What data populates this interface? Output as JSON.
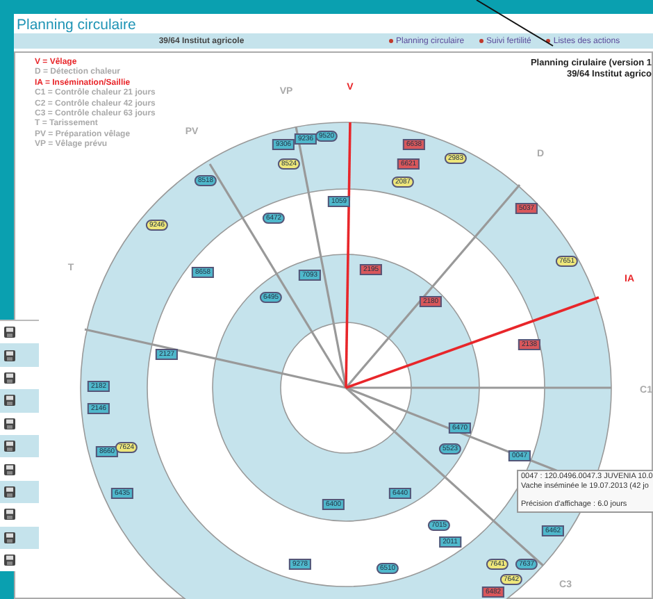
{
  "page_title": "Planning circulaire",
  "nav_bar": {
    "farm": "39/64 Institut agricole",
    "links": [
      {
        "label": "Planning circulaire"
      },
      {
        "label": "Suivi fertilité"
      },
      {
        "label": "Listes des actions"
      }
    ]
  },
  "legend": [
    {
      "text": "V = Vêlage",
      "highlighted": true
    },
    {
      "text": "D = Détection chaleur",
      "highlighted": false
    },
    {
      "text": "IA = Insémination/Saillie",
      "highlighted": true
    },
    {
      "text": "C1 = Contrôle chaleur 21 jours",
      "highlighted": false
    },
    {
      "text": "C2 = Contrôle chaleur 42 jours",
      "highlighted": false
    },
    {
      "text": "C3 = Contrôle chaleur 63 jours",
      "highlighted": false
    },
    {
      "text": "T = Tarissement",
      "highlighted": false
    },
    {
      "text": "PV = Préparation vêlage",
      "highlighted": false
    },
    {
      "text": "VP = Vêlage prévu",
      "highlighted": false
    }
  ],
  "report_header": [
    "Planning cirulaire (version 1",
    "39/64 Institut agrico"
  ],
  "sectors": [
    {
      "label": "V",
      "highlighted": true
    },
    {
      "label": "VP",
      "highlighted": false
    },
    {
      "label": "PV",
      "highlighted": false
    },
    {
      "label": "D",
      "highlighted": false
    },
    {
      "label": "IA",
      "highlighted": true
    },
    {
      "label": "T",
      "highlighted": false
    },
    {
      "label": "C1",
      "highlighted": false
    },
    {
      "label": "C3",
      "highlighted": false
    }
  ],
  "cows": [
    {
      "label": "9306",
      "kind": "rect",
      "color": "#4fb8cc"
    },
    {
      "label": "9236",
      "kind": "rect",
      "color": "#4fb8cc"
    },
    {
      "label": "9520",
      "kind": "oval",
      "color": "#4fb8cc"
    },
    {
      "label": "8524",
      "kind": "oval",
      "color": "#eee67a"
    },
    {
      "label": "8518",
      "kind": "oval",
      "color": "#4fb8cc"
    },
    {
      "label": "9246",
      "kind": "oval",
      "color": "#eee67a"
    },
    {
      "label": "1059",
      "kind": "rect",
      "color": "#4fb8cc"
    },
    {
      "label": "6472",
      "kind": "oval",
      "color": "#4fb8cc"
    },
    {
      "label": "8658",
      "kind": "rect",
      "color": "#4fb8cc"
    },
    {
      "label": "7093",
      "kind": "rect",
      "color": "#4fb8cc"
    },
    {
      "label": "6495",
      "kind": "oval",
      "color": "#4fb8cc"
    },
    {
      "label": "2195",
      "kind": "rect",
      "color": "#d9575b"
    },
    {
      "label": "2180",
      "kind": "rect",
      "color": "#d9575b"
    },
    {
      "label": "6638",
      "kind": "rect",
      "color": "#d9575b"
    },
    {
      "label": "6621",
      "kind": "rect",
      "color": "#d9575b"
    },
    {
      "label": "2983",
      "kind": "oval",
      "color": "#eee67a"
    },
    {
      "label": "2087",
      "kind": "oval",
      "color": "#eee67a"
    },
    {
      "label": "5037",
      "kind": "rect",
      "color": "#d9575b"
    },
    {
      "label": "7651",
      "kind": "oval",
      "color": "#eee67a"
    },
    {
      "label": "2127",
      "kind": "rect",
      "color": "#4fb8cc"
    },
    {
      "label": "2182",
      "kind": "rect",
      "color": "#4fb8cc"
    },
    {
      "label": "2146",
      "kind": "rect",
      "color": "#4fb8cc"
    },
    {
      "label": "8660",
      "kind": "rect",
      "color": "#4fb8cc"
    },
    {
      "label": "7624",
      "kind": "oval",
      "color": "#eee67a"
    },
    {
      "label": "6435",
      "kind": "rect",
      "color": "#4fb8cc"
    },
    {
      "label": "2138",
      "kind": "rect",
      "color": "#d9575b"
    },
    {
      "label": "6470",
      "kind": "rect",
      "color": "#4fb8cc"
    },
    {
      "label": "5523",
      "kind": "oval",
      "color": "#4fb8cc"
    },
    {
      "label": "0047",
      "kind": "rect",
      "color": "#4fb8cc"
    },
    {
      "label": "6440",
      "kind": "rect",
      "color": "#4fb8cc"
    },
    {
      "label": "6400",
      "kind": "rect",
      "color": "#4fb8cc"
    },
    {
      "label": "7015",
      "kind": "oval",
      "color": "#4fb8cc"
    },
    {
      "label": "2011",
      "kind": "rect",
      "color": "#4fb8cc"
    },
    {
      "label": "6462",
      "kind": "rect",
      "color": "#4fb8cc"
    },
    {
      "label": "7641",
      "kind": "oval",
      "color": "#eee67a"
    },
    {
      "label": "7637",
      "kind": "oval",
      "color": "#4fb8cc"
    },
    {
      "label": "7642",
      "kind": "oval",
      "color": "#eee67a"
    },
    {
      "label": "6482",
      "kind": "rect",
      "color": "#d9575b"
    },
    {
      "label": "9278",
      "kind": "rect",
      "color": "#4fb8cc"
    },
    {
      "label": "6510",
      "kind": "oval",
      "color": "#4fb8cc"
    }
  ],
  "tooltip": {
    "lines": [
      "0047 : 120.0496.0047.3  JUVENIA  10.0",
      "Vache inséminée le 19.07.2013  (42 jo"
    ],
    "note": "Précision d'affichage : 6.0 jours"
  }
}
